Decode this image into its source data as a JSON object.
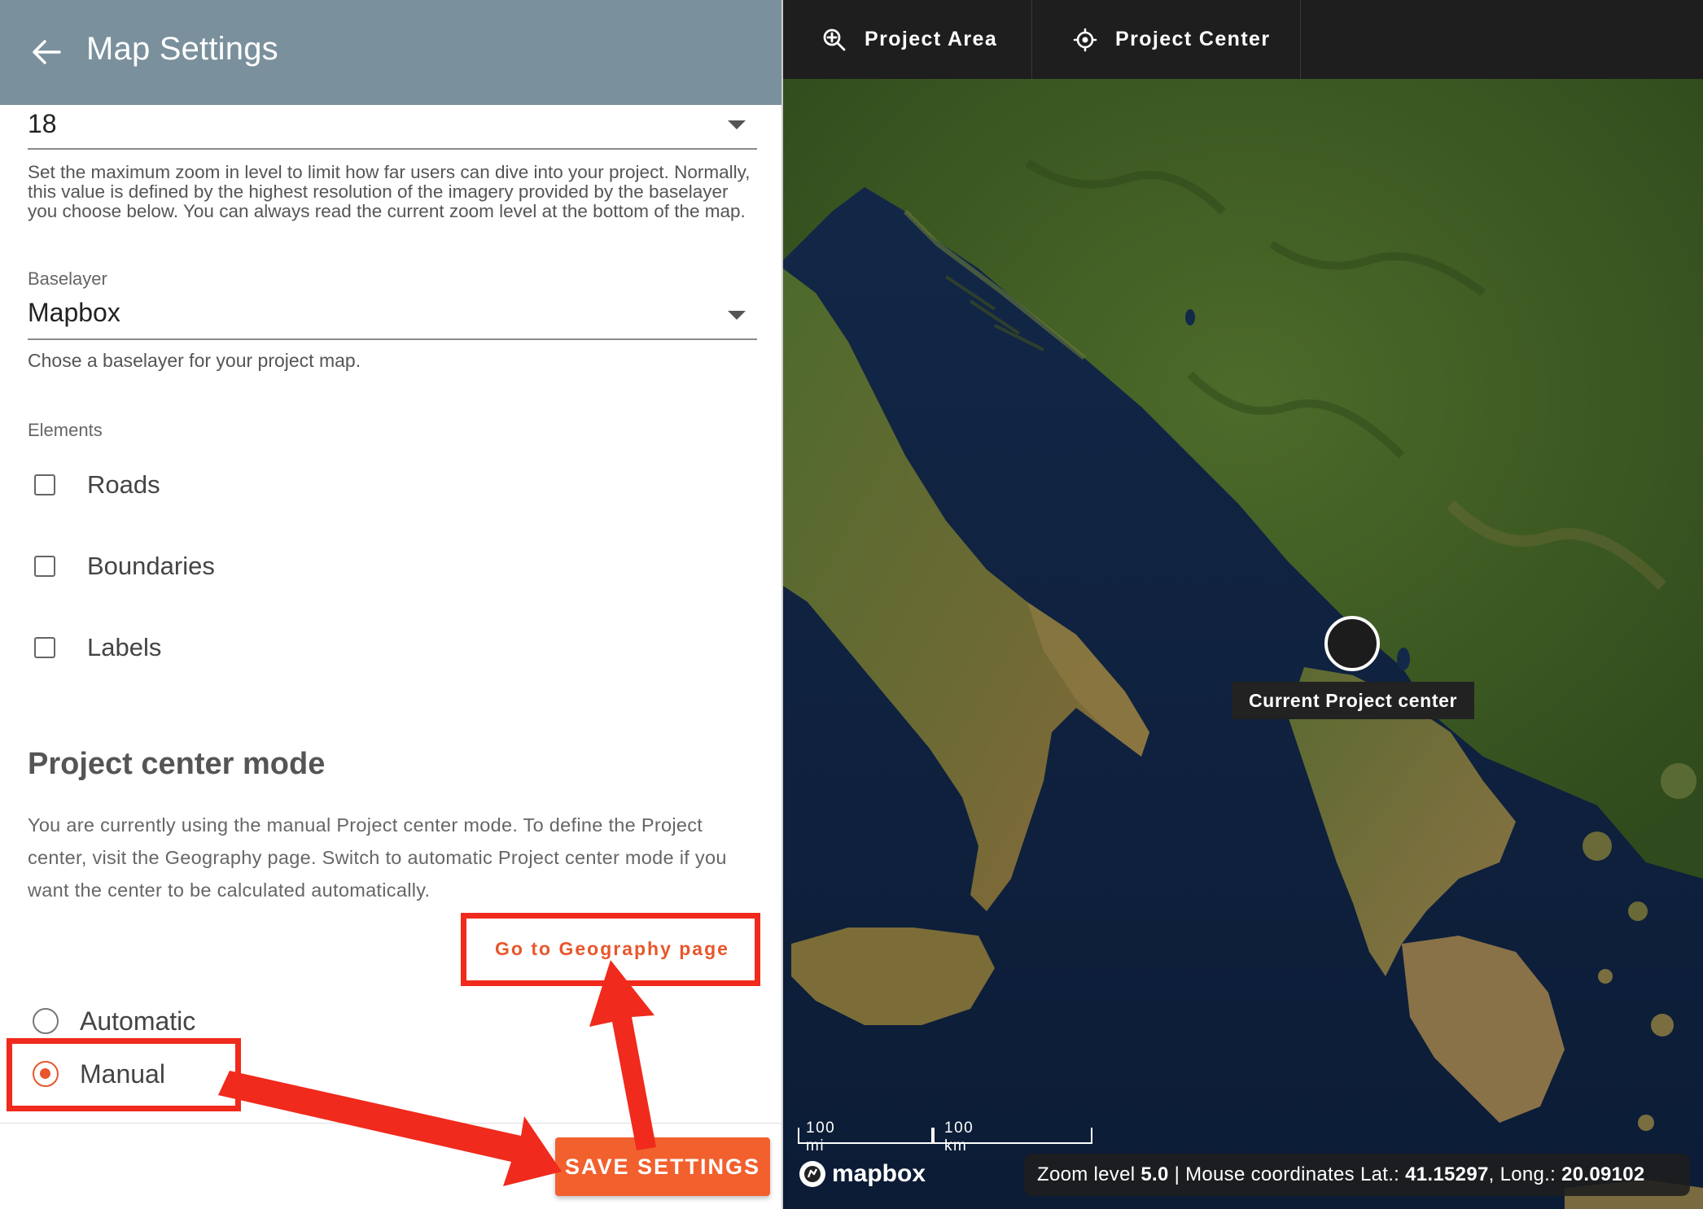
{
  "colors": {
    "header_bg": "#7a909c",
    "accent": "#e8562b",
    "save_bg": "#f2602e",
    "annotation_red": "#f02a1c",
    "map_toolbar_bg": "#1e1e1e"
  },
  "header": {
    "back_icon": "arrow-left-icon",
    "title": "Map Settings"
  },
  "max_zoom": {
    "value": "18",
    "help": "Set the maximum zoom in level to limit how far users can dive into your project. Normally, this value is defined by the highest resolution of the imagery provided by the baselayer you choose below. You can always read the current zoom level at the bottom of the map."
  },
  "baselayer": {
    "label": "Baselayer",
    "value": "Mapbox",
    "help": "Chose a baselayer for your project map."
  },
  "elements": {
    "label": "Elements",
    "items": [
      {
        "label": "Roads",
        "checked": false
      },
      {
        "label": "Boundaries",
        "checked": false
      },
      {
        "label": "Labels",
        "checked": false
      }
    ]
  },
  "project_center": {
    "title": "Project center mode",
    "description": "You are currently using the manual Project center mode. To define the Project center, visit the Geography page. Switch to automatic Project center mode if you want the center to be calculated automatically.",
    "geography_button": "Go to Geography page",
    "options": [
      {
        "label": "Automatic",
        "selected": false
      },
      {
        "label": "Manual",
        "selected": true
      }
    ]
  },
  "footer": {
    "save_button": "SAVE SETTINGS"
  },
  "map": {
    "toolbar": [
      {
        "label": "Project Area",
        "icon": "zoom-in-icon"
      },
      {
        "label": "Project Center",
        "icon": "crosshair-icon"
      }
    ],
    "marker_tooltip": "Current Project center",
    "scale": {
      "miles": "100 mi",
      "km": "100 km"
    },
    "logo_text": "mapbox",
    "status": {
      "zoom_label": "Zoom level",
      "zoom_value": "5.0",
      "separator": "|",
      "coords_label": "Mouse coordinates Lat.:",
      "lat_value": "41.15297",
      "long_label": ", Long.:",
      "long_value": "20.09102"
    }
  }
}
